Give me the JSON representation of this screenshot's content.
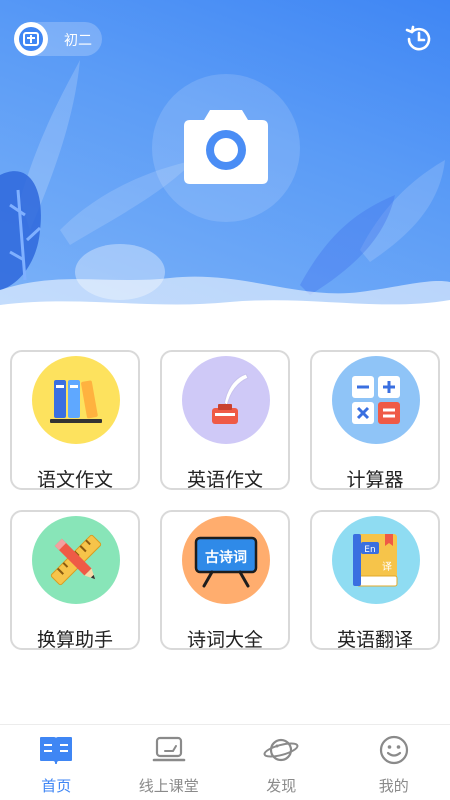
{
  "header": {
    "grade_label": "初二"
  },
  "features": [
    {
      "label": "语文作文",
      "icon": "books-icon",
      "color": "#fde25e"
    },
    {
      "label": "英语作文",
      "icon": "inkwell-quill-icon",
      "color": "#cfc9f7"
    },
    {
      "label": "计算器",
      "icon": "calculator-icon",
      "color": "#8fc4f7"
    },
    {
      "label": "换算助手",
      "icon": "ruler-pencil-icon",
      "color": "#88e5b8"
    },
    {
      "label": "诗词大全",
      "icon": "poetry-board-icon",
      "color": "#ffad6e",
      "badge_text": "古诗词"
    },
    {
      "label": "英语翻译",
      "icon": "dictionary-book-icon",
      "color": "#8fdcf2",
      "badge_en": "En",
      "badge_zh": "译"
    }
  ],
  "tabbar": {
    "items": [
      {
        "label": "首页",
        "icon": "book-open-icon",
        "active": true
      },
      {
        "label": "线上课堂",
        "icon": "laptop-icon",
        "active": false
      },
      {
        "label": "发现",
        "icon": "planet-icon",
        "active": false
      },
      {
        "label": "我的",
        "icon": "smiley-face-icon",
        "active": false
      }
    ]
  },
  "colors": {
    "brand": "#3f86f4",
    "inactive": "#8a8a8a"
  }
}
